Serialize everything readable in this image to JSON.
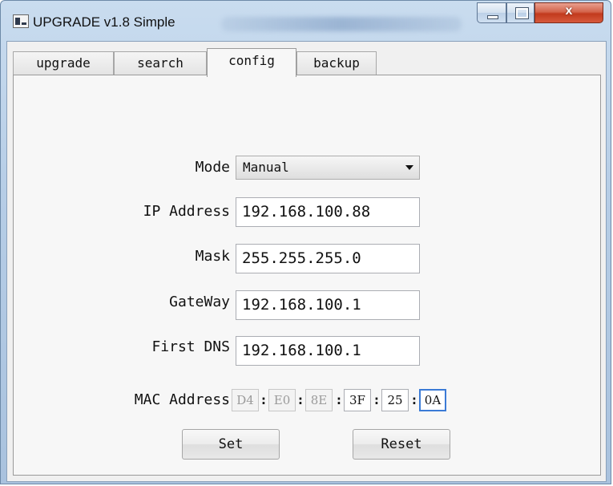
{
  "window": {
    "title": "UPGRADE v1.8 Simple",
    "close_glyph": "x"
  },
  "tabs": [
    {
      "label": "upgrade"
    },
    {
      "label": "search"
    },
    {
      "label": "config",
      "active": true
    },
    {
      "label": "backup"
    }
  ],
  "form": {
    "mode_label": "Mode",
    "mode_value": "Manual",
    "ip_label": "IP Address",
    "ip_value": "192.168.100.88",
    "mask_label": "Mask",
    "mask_value": "255.255.255.0",
    "gateway_label": "GateWay",
    "gateway_value": "192.168.100.1",
    "dns_label": "First DNS",
    "dns_value": "192.168.100.1",
    "mac_label": "MAC Address",
    "mac_separator": ":",
    "mac_octets": [
      "D4",
      "E0",
      "8E",
      "3F",
      "25",
      "0A"
    ]
  },
  "buttons": {
    "set_label": "Set",
    "reset_label": "Reset"
  }
}
